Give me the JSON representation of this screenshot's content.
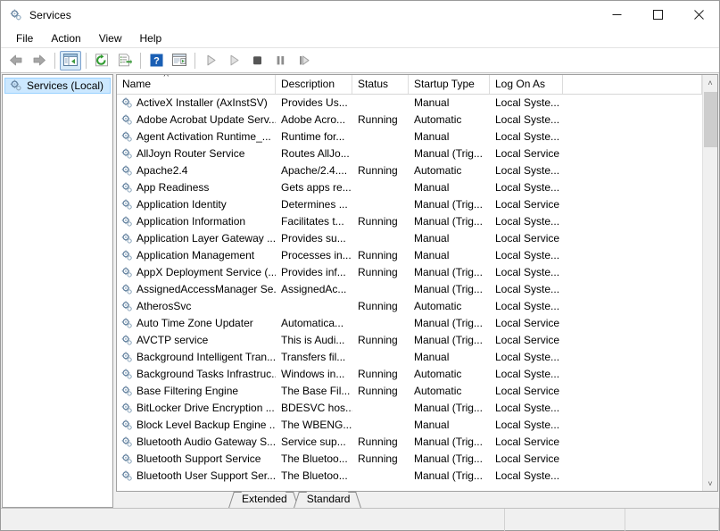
{
  "window": {
    "title": "Services",
    "icon": "services-gear-icon",
    "controls": {
      "minimize": "minimize",
      "maximize": "maximize",
      "close": "close"
    }
  },
  "menubar": {
    "items": [
      {
        "label": "File"
      },
      {
        "label": "Action"
      },
      {
        "label": "View"
      },
      {
        "label": "Help"
      }
    ]
  },
  "toolbar": {
    "buttons": [
      {
        "name": "back-icon",
        "pressed": false
      },
      {
        "name": "forward-icon",
        "pressed": false
      },
      {
        "name": "show-console-tree-icon",
        "pressed": true
      },
      {
        "name": "refresh-icon",
        "pressed": false
      },
      {
        "name": "export-list-icon",
        "pressed": false
      },
      {
        "name": "help-icon",
        "pressed": false
      },
      {
        "name": "properties-icon",
        "pressed": false
      },
      {
        "name": "start-service-icon",
        "pressed": false
      },
      {
        "name": "restart-service-icon",
        "pressed": false
      },
      {
        "name": "stop-service-icon",
        "pressed": false
      },
      {
        "name": "pause-service-icon",
        "pressed": false
      },
      {
        "name": "resume-service-icon",
        "pressed": false
      }
    ]
  },
  "sidebar": {
    "items": [
      {
        "label": "Services (Local)",
        "icon": "services-gear-icon",
        "selected": true
      }
    ]
  },
  "list": {
    "sort": {
      "column": "Name",
      "direction": "ascending",
      "caret": "˄"
    },
    "columns": [
      {
        "key": "name",
        "label": "Name"
      },
      {
        "key": "description",
        "label": "Description"
      },
      {
        "key": "status",
        "label": "Status"
      },
      {
        "key": "startup",
        "label": "Startup Type"
      },
      {
        "key": "logon",
        "label": "Log On As"
      }
    ],
    "rows": [
      {
        "name": "ActiveX Installer (AxInstSV)",
        "description": "Provides Us...",
        "status": "",
        "startup": "Manual",
        "logon": "Local Syste..."
      },
      {
        "name": "Adobe Acrobat Update Serv...",
        "description": "Adobe Acro...",
        "status": "Running",
        "startup": "Automatic",
        "logon": "Local Syste..."
      },
      {
        "name": "Agent Activation Runtime_...",
        "description": "Runtime for...",
        "status": "",
        "startup": "Manual",
        "logon": "Local Syste..."
      },
      {
        "name": "AllJoyn Router Service",
        "description": "Routes AllJo...",
        "status": "",
        "startup": "Manual (Trig...",
        "logon": "Local Service"
      },
      {
        "name": "Apache2.4",
        "description": "Apache/2.4....",
        "status": "Running",
        "startup": "Automatic",
        "logon": "Local Syste..."
      },
      {
        "name": "App Readiness",
        "description": "Gets apps re...",
        "status": "",
        "startup": "Manual",
        "logon": "Local Syste..."
      },
      {
        "name": "Application Identity",
        "description": "Determines ...",
        "status": "",
        "startup": "Manual (Trig...",
        "logon": "Local Service"
      },
      {
        "name": "Application Information",
        "description": "Facilitates t...",
        "status": "Running",
        "startup": "Manual (Trig...",
        "logon": "Local Syste..."
      },
      {
        "name": "Application Layer Gateway ...",
        "description": "Provides su...",
        "status": "",
        "startup": "Manual",
        "logon": "Local Service"
      },
      {
        "name": "Application Management",
        "description": "Processes in...",
        "status": "Running",
        "startup": "Manual",
        "logon": "Local Syste..."
      },
      {
        "name": "AppX Deployment Service (...",
        "description": "Provides inf...",
        "status": "Running",
        "startup": "Manual (Trig...",
        "logon": "Local Syste..."
      },
      {
        "name": "AssignedAccessManager Se...",
        "description": "AssignedAc...",
        "status": "",
        "startup": "Manual (Trig...",
        "logon": "Local Syste..."
      },
      {
        "name": "AtherosSvc",
        "description": "",
        "status": "Running",
        "startup": "Automatic",
        "logon": "Local Syste..."
      },
      {
        "name": "Auto Time Zone Updater",
        "description": "Automatica...",
        "status": "",
        "startup": "Manual (Trig...",
        "logon": "Local Service"
      },
      {
        "name": "AVCTP service",
        "description": "This is Audi...",
        "status": "Running",
        "startup": "Manual (Trig...",
        "logon": "Local Service"
      },
      {
        "name": "Background Intelligent Tran...",
        "description": "Transfers fil...",
        "status": "",
        "startup": "Manual",
        "logon": "Local Syste..."
      },
      {
        "name": "Background Tasks Infrastruc...",
        "description": "Windows in...",
        "status": "Running",
        "startup": "Automatic",
        "logon": "Local Syste..."
      },
      {
        "name": "Base Filtering Engine",
        "description": "The Base Fil...",
        "status": "Running",
        "startup": "Automatic",
        "logon": "Local Service"
      },
      {
        "name": "BitLocker Drive Encryption ...",
        "description": "BDESVC hos...",
        "status": "",
        "startup": "Manual (Trig...",
        "logon": "Local Syste..."
      },
      {
        "name": "Block Level Backup Engine ...",
        "description": "The WBENG...",
        "status": "",
        "startup": "Manual",
        "logon": "Local Syste..."
      },
      {
        "name": "Bluetooth Audio Gateway S...",
        "description": "Service sup...",
        "status": "Running",
        "startup": "Manual (Trig...",
        "logon": "Local Service"
      },
      {
        "name": "Bluetooth Support Service",
        "description": "The Bluetoo...",
        "status": "Running",
        "startup": "Manual (Trig...",
        "logon": "Local Service"
      },
      {
        "name": "Bluetooth User Support Ser...",
        "description": "The Bluetoo...",
        "status": "",
        "startup": "Manual (Trig...",
        "logon": "Local Syste..."
      }
    ]
  },
  "tabs": [
    {
      "label": "Extended",
      "active": true
    },
    {
      "label": "Standard",
      "active": false
    }
  ],
  "statusbar": {
    "text": ""
  },
  "scrollbar": {
    "up": "˄",
    "down": "˅"
  },
  "colors": {
    "selection": "#cce8ff",
    "toolbar_pressed": "#7da2ce",
    "window_bg": "#f0f0f0",
    "list_bg": "#ffffff"
  }
}
